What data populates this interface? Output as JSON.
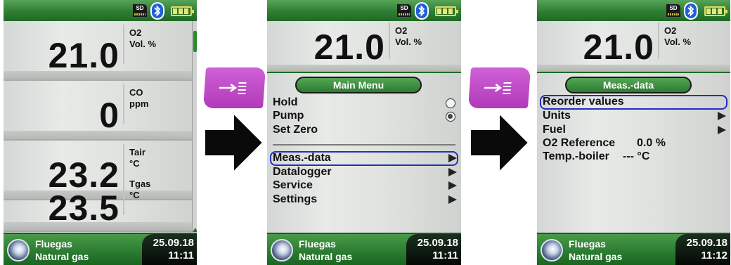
{
  "colors": {
    "status_green": "#2f7e34",
    "key_magenta": "#c04cc8",
    "selection_blue": "#2030c0"
  },
  "status_icons": [
    "sd-card-icon",
    "bluetooth-icon",
    "battery-icon"
  ],
  "status": {
    "sd_label": "SD"
  },
  "screen1": {
    "rows": [
      {
        "value": "21.0",
        "gas": "O2",
        "unit": "Vol. %"
      },
      {
        "value": "0",
        "gas": "CO",
        "unit": "ppm"
      },
      {
        "value": "23.2",
        "gas": "Tair",
        "unit": "°C"
      },
      {
        "value": "23.5",
        "gas": "Tgas",
        "unit": "°C"
      }
    ],
    "footer": {
      "line1": "Fluegas",
      "line2": "Natural gas",
      "date": "25.09.18",
      "time": "11:11"
    }
  },
  "screen2": {
    "top": {
      "value": "21.0",
      "gas": "O2",
      "unit": "Vol. %"
    },
    "menu_title": "Main Menu",
    "items": [
      {
        "label": "Hold",
        "control": "radio-off"
      },
      {
        "label": "Pump",
        "control": "radio-on"
      },
      {
        "label": "Set Zero"
      },
      {
        "label": "Meas.-data",
        "control": "submenu",
        "selected": true
      },
      {
        "label": "Datalogger",
        "control": "submenu"
      },
      {
        "label": "Service",
        "control": "submenu"
      },
      {
        "label": "Settings",
        "control": "submenu"
      }
    ],
    "footer": {
      "line1": "Fluegas",
      "line2": "Natural gas",
      "date": "25.09.18",
      "time": "11:11"
    }
  },
  "screen3": {
    "top": {
      "value": "21.0",
      "gas": "O2",
      "unit": "Vol. %"
    },
    "menu_title": "Meas.-data",
    "items": [
      {
        "label": "Reorder values",
        "selected": true
      },
      {
        "label": "Units",
        "control": "submenu"
      },
      {
        "label": "Fuel",
        "control": "submenu"
      },
      {
        "label": "O2 Reference",
        "value": "0.0 %"
      },
      {
        "label": "Temp.-boiler",
        "value": "--- °C"
      }
    ],
    "footer": {
      "line1": "Fluegas",
      "line2": "Natural gas",
      "date": "25.09.18",
      "time": "11:12"
    }
  }
}
